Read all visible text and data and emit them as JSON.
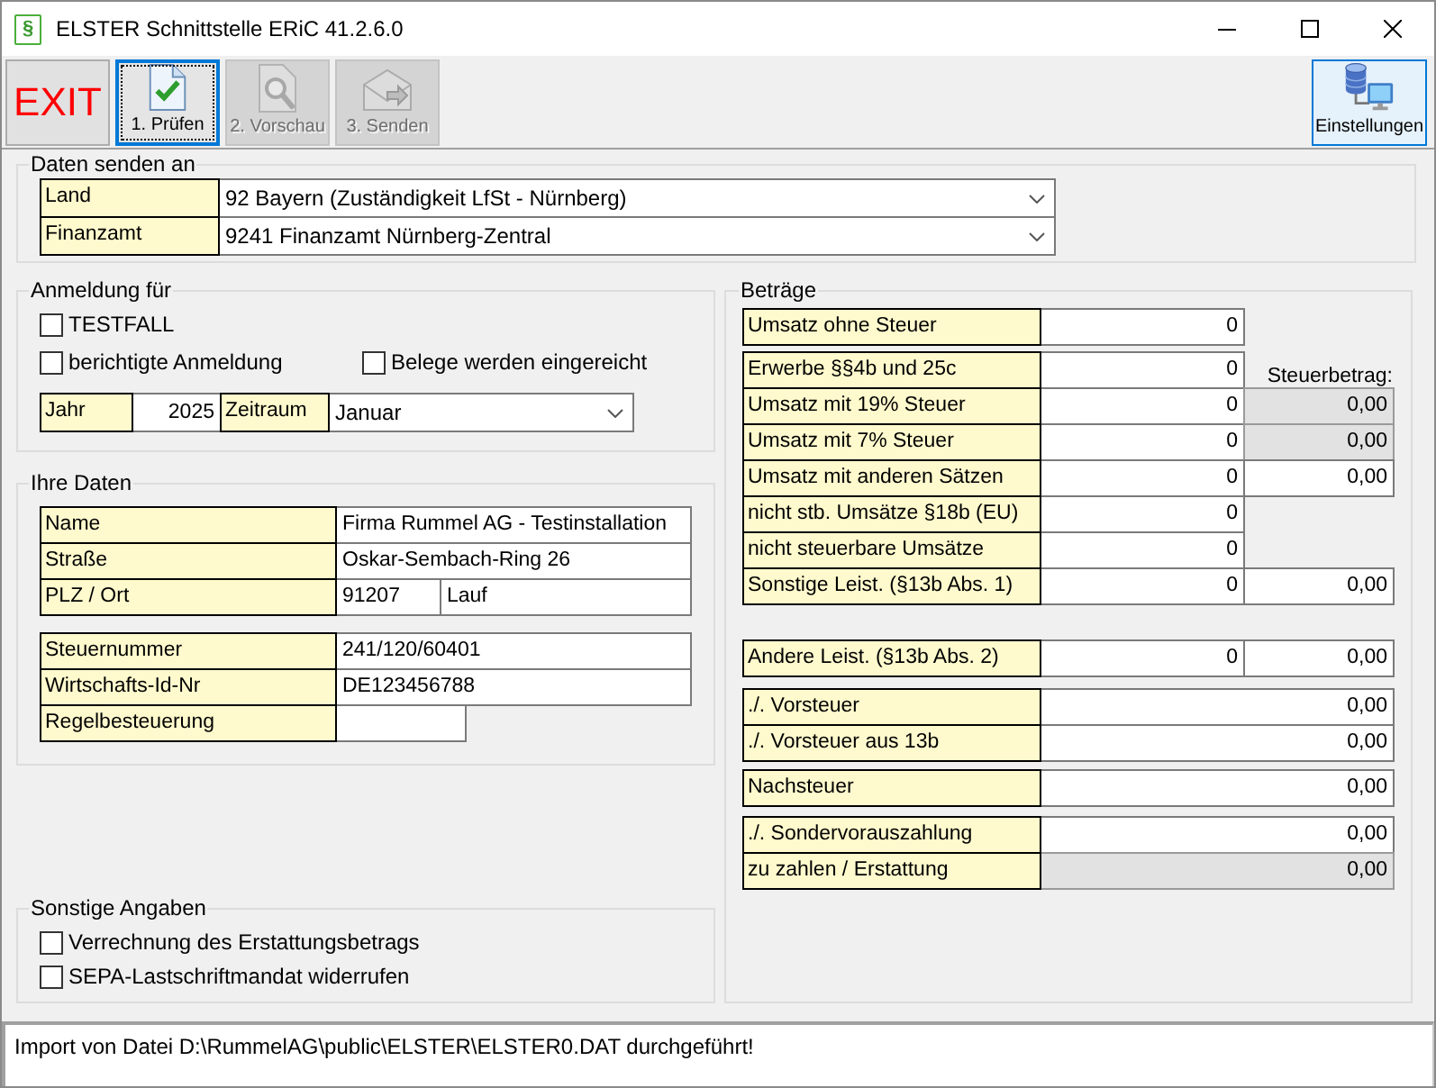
{
  "window": {
    "icon_text": "§",
    "title": "ELSTER Schnittstelle ERiC 41.2.6.0"
  },
  "toolbar": {
    "buttons": [
      {
        "kind": "exit",
        "label": "EXIT",
        "selected": false,
        "disabled": false
      },
      {
        "kind": "check",
        "label": "1. Prüfen",
        "selected": true,
        "disabled": false
      },
      {
        "kind": "preview",
        "label": "2. Vorschau",
        "selected": false,
        "disabled": true
      },
      {
        "kind": "send",
        "label": "3. Senden",
        "selected": false,
        "disabled": true
      }
    ],
    "settings": {
      "label": "Einstellungen",
      "highlighted": true
    }
  },
  "recipient": {
    "title": "Daten senden an",
    "fields": [
      {
        "label": "Land",
        "value": "92 Bayern (Zuständigkeit LfSt - Nürnberg)"
      },
      {
        "label": "Finanzamt",
        "value": "9241 Finanzamt Nürnberg-Zentral"
      }
    ]
  },
  "registration": {
    "title": "Anmeldung für",
    "option_rows": [
      [
        {
          "label": "TESTFALL",
          "checked": false
        }
      ],
      [
        {
          "label": "berichtigte Anmeldung",
          "checked": false
        },
        {
          "label": "Belege werden eingereicht",
          "checked": false
        }
      ]
    ],
    "year": {
      "label": "Jahr",
      "value": "2025"
    },
    "period": {
      "label": "Zeitraum",
      "value": "Januar"
    }
  },
  "your_data": {
    "title": "Ihre Daten",
    "address": [
      {
        "label": "Name",
        "values": [
          "Firma Rummel AG - Testinstallation"
        ]
      },
      {
        "label": "Straße",
        "values": [
          "Oskar-Sembach-Ring 26"
        ]
      },
      {
        "label": "PLZ / Ort",
        "values": [
          "91207",
          "Lauf"
        ]
      }
    ],
    "tax_ids": [
      {
        "kind": "full",
        "label": "Steuernummer",
        "value": "241/120/60401"
      },
      {
        "kind": "full",
        "label": "Wirtschafts-Id-Nr",
        "value": "DE123456788"
      },
      {
        "kind": "short",
        "label": "Regelbesteuerung"
      }
    ]
  },
  "other": {
    "title": "Sonstige Angaben",
    "options": [
      {
        "label": "Verrechnung des Erstattungsbetrags",
        "checked": false
      },
      {
        "label": "SEPA-Lastschriftmandat widerrufen",
        "checked": false
      }
    ]
  },
  "amounts": {
    "title": "Beträge",
    "blocks": [
      {
        "rows": [
          {
            "kind": "basis",
            "label": "Umsatz ohne Steuer",
            "amount": "0"
          }
        ]
      },
      {
        "rows": [
          {
            "kind": "basis",
            "label": "Erwerbe §§4b und 25c",
            "amount": "0",
            "tax_heading": "Steuerbetrag:"
          },
          {
            "kind": "basis",
            "label": "Umsatz mit 19% Steuer",
            "amount": "0",
            "tax": "0,00",
            "tax_readonly": true
          },
          {
            "kind": "basis",
            "label": "Umsatz mit 7% Steuer",
            "amount": "0",
            "tax": "0,00",
            "tax_readonly": true
          },
          {
            "kind": "basis",
            "label": "Umsatz mit anderen Sätzen",
            "amount": "0",
            "tax": "0,00",
            "tax_readonly": false
          },
          {
            "kind": "basis",
            "label": "nicht stb. Umsätze §18b (EU)",
            "amount": "0"
          },
          {
            "kind": "basis",
            "label": "nicht steuerbare Umsätze",
            "amount": "0"
          },
          {
            "kind": "basis",
            "label": "Sonstige Leist. (§13b Abs. 1)",
            "amount": "0",
            "tax": "0,00",
            "tax_readonly": false
          }
        ]
      },
      {
        "rows": [
          {
            "kind": "basis",
            "label": "Andere Leist. (§13b Abs. 2)",
            "amount": "0",
            "tax": "0,00",
            "tax_readonly": false
          }
        ]
      },
      {
        "rows": [
          {
            "kind": "total",
            "label": "./. Vorsteuer",
            "value": "0,00",
            "readonly": false
          },
          {
            "kind": "total",
            "label": "./. Vorsteuer aus 13b",
            "value": "0,00",
            "readonly": false
          }
        ]
      },
      {
        "rows": [
          {
            "kind": "total",
            "label": "Nachsteuer",
            "value": "0,00",
            "readonly": false
          }
        ]
      },
      {
        "rows": [
          {
            "kind": "total",
            "label": "./. Sondervorauszahlung",
            "value": "0,00",
            "readonly": false
          },
          {
            "kind": "total",
            "label": "zu zahlen / Erstattung",
            "value": "0,00",
            "readonly": true
          }
        ]
      }
    ]
  },
  "status_bar": {
    "message": "Import von Datei D:\\RummelAG\\public\\ELSTER\\ELSTER0.DAT durchgeführt!"
  }
}
